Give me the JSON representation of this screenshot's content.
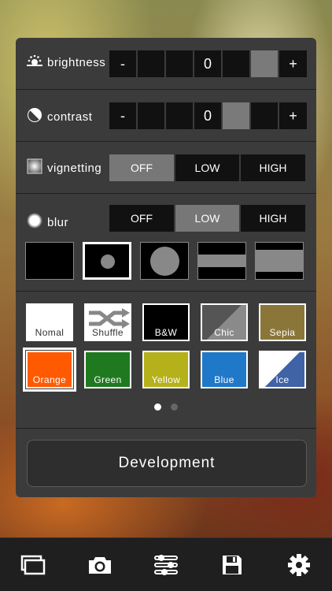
{
  "brightness": {
    "label": "brightness",
    "cells": [
      "-",
      "",
      "",
      "0",
      "",
      "",
      "+"
    ],
    "active_index": 5
  },
  "contrast": {
    "label": "contrast",
    "cells": [
      "-",
      "",
      "",
      "0",
      "",
      "",
      "+"
    ],
    "active_index": 4
  },
  "vignetting": {
    "label": "vignetting",
    "options": [
      "OFF",
      "LOW",
      "HIGH"
    ],
    "selected": "OFF"
  },
  "blur": {
    "label": "blur",
    "options": [
      "OFF",
      "LOW",
      "HIGH"
    ],
    "selected": "LOW",
    "shapes": [
      "none",
      "small-circle",
      "large-circle",
      "narrow-band",
      "wide-band"
    ],
    "selected_shape": "small-circle"
  },
  "filters": {
    "items": [
      {
        "label": "Nomal",
        "color": "#ffffff"
      },
      {
        "label": "Shuffle",
        "color": "#ffffff"
      },
      {
        "label": "B&W",
        "color": "#000000"
      },
      {
        "label": "Chic",
        "color": "#555555"
      },
      {
        "label": "Sepia",
        "color": "#8a7638"
      },
      {
        "label": "Orange",
        "color": "#ff5a00"
      },
      {
        "label": "Green",
        "color": "#1f7a1f"
      },
      {
        "label": "Yellow",
        "color": "#b5b11a"
      },
      {
        "label": "Blue",
        "color": "#1f78c8"
      },
      {
        "label": "Ice",
        "color": "#3f63a6"
      }
    ],
    "selected": "Orange",
    "page": 1,
    "page_count": 2
  },
  "development": {
    "label": "Development"
  },
  "toolbar": {
    "icons": [
      "gallery-icon",
      "camera-icon",
      "sliders-icon",
      "save-icon",
      "gear-icon"
    ]
  },
  "colors": {
    "panel": "#3b3b3b",
    "active_segment": "#777777"
  }
}
